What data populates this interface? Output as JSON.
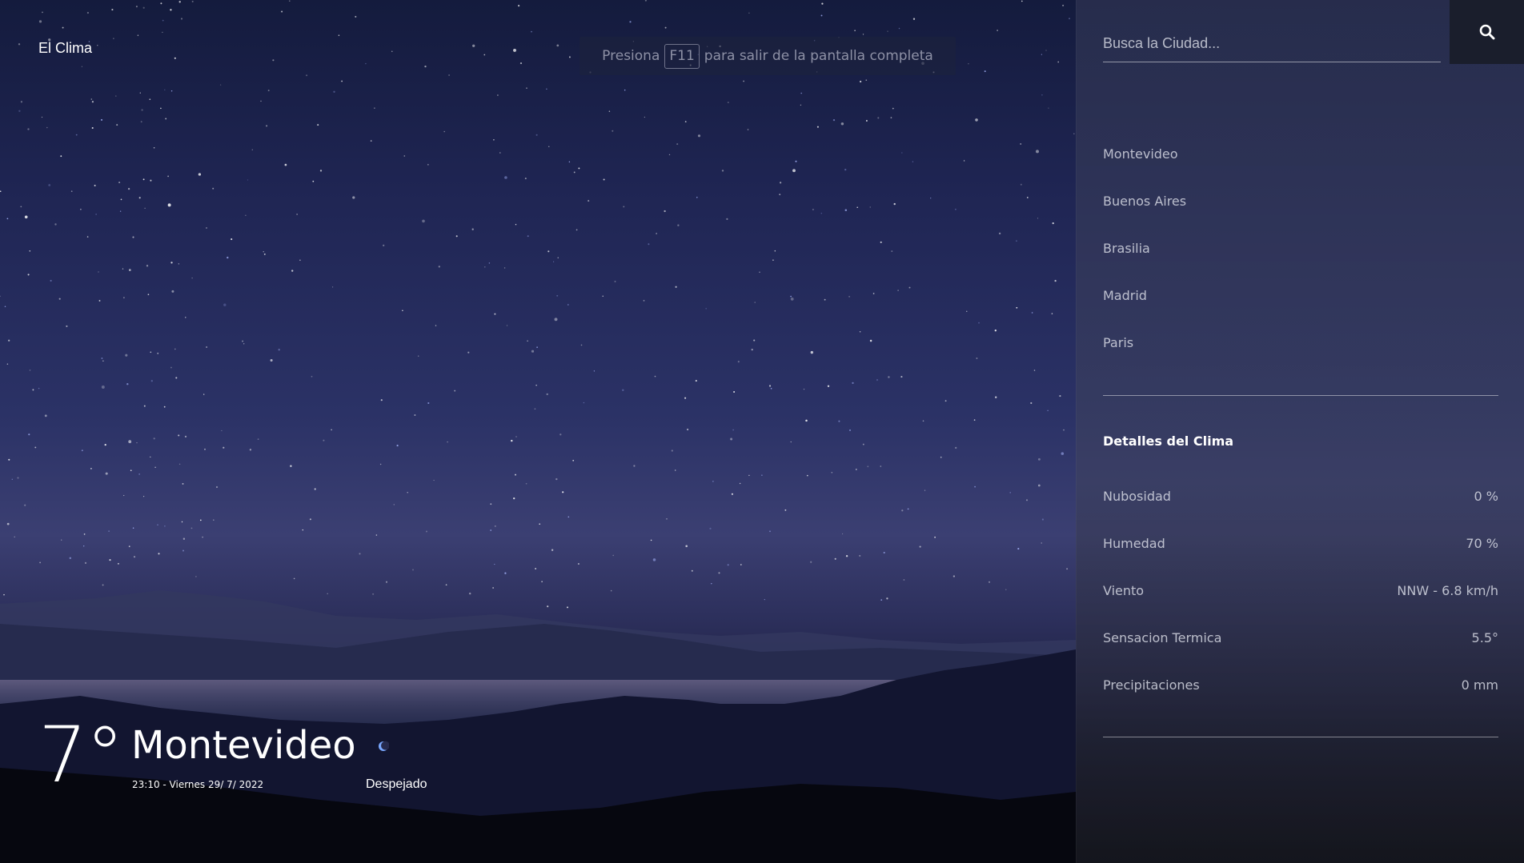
{
  "app": {
    "title": "El Clima"
  },
  "fullscreen_hint": {
    "before": "Presiona",
    "key": "F11",
    "after": "para salir de la pantalla completa"
  },
  "current": {
    "temperature": "7°",
    "city": "Montevideo",
    "datetime": "23:10 - Viernes 29/ 7/ 2022",
    "condition": "Despejado",
    "condition_icon": "crescent-moon-icon"
  },
  "search": {
    "placeholder": "Busca la Ciudad...",
    "button_icon": "search-icon"
  },
  "cities": [
    {
      "label": "Montevideo"
    },
    {
      "label": "Buenos Aires"
    },
    {
      "label": "Brasilia"
    },
    {
      "label": "Madrid"
    },
    {
      "label": "Paris"
    }
  ],
  "details": {
    "title": "Detalles del Clima",
    "rows": [
      {
        "label": "Nubosidad",
        "value": "0 %"
      },
      {
        "label": "Humedad",
        "value": "70 %"
      },
      {
        "label": "Viento",
        "value": "NNW - 6.8 km/h"
      },
      {
        "label": "Sensacion Termica",
        "value": "5.5°"
      },
      {
        "label": "Precipitaciones",
        "value": "0 mm"
      }
    ]
  },
  "colors": {
    "panel": "#3a3f5f",
    "search_button": "#1a1e2c",
    "sky": "#2b3266",
    "moon": "#7aa8ff"
  }
}
